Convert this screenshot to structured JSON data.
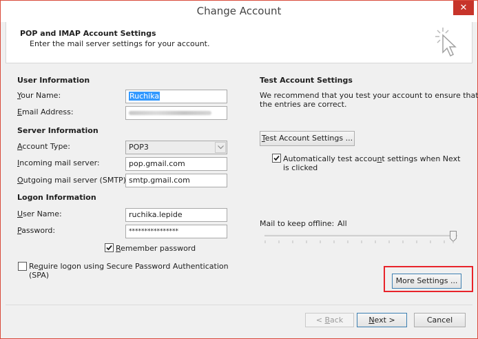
{
  "window": {
    "title": "Change Account",
    "close_glyph": "✕"
  },
  "header": {
    "title": "POP and IMAP Account Settings",
    "subtitle": "Enter the mail server settings for your account."
  },
  "user_info": {
    "section_label": "User Information",
    "name_label": "Your Name:",
    "name_value": "Ruchika",
    "email_label": "Email Address:",
    "email_value": "ruchika.lepide@gmail.com"
  },
  "server_info": {
    "section_label": "Server Information",
    "account_type_label": "Account Type:",
    "account_type_value": "POP3",
    "incoming_label": "Incoming mail server:",
    "incoming_value": "pop.gmail.com",
    "outgoing_label": "Outgoing mail server (SMTP):",
    "outgoing_value": "smtp.gmail.com"
  },
  "logon_info": {
    "section_label": "Logon Information",
    "username_label": "User Name:",
    "username_value": "ruchika.lepide",
    "password_label": "Password:",
    "password_value": "****************",
    "remember_label": "Remember password",
    "remember_checked": true,
    "spa_label_line1": "Require logon using Secure Password Authentication",
    "spa_label_line2": "(SPA)",
    "spa_checked": false
  },
  "test_settings": {
    "section_label": "Test Account Settings",
    "description_line1": "We recommend that you test your account to ensure that",
    "description_line2": "the entries are correct.",
    "test_button": "Test Account Settings ...",
    "auto_test_line1": "Automatically test account settings when Next",
    "auto_test_line2": "is clicked",
    "auto_test_checked": true
  },
  "offline": {
    "label": "Mail to keep offline:",
    "value": "All",
    "slider_fraction": 1.0
  },
  "buttons": {
    "more_settings": "More Settings ...",
    "back": "< Back",
    "next": "Next >",
    "cancel": "Cancel"
  },
  "colors": {
    "highlight": "#e8232a",
    "selection": "#3399ff",
    "close_button": "#c7342a"
  },
  "icons": {
    "header": "cursor-click-icon",
    "close": "close-icon",
    "dropdown": "chevron-down-icon",
    "checkbox": "checkmark-icon"
  }
}
